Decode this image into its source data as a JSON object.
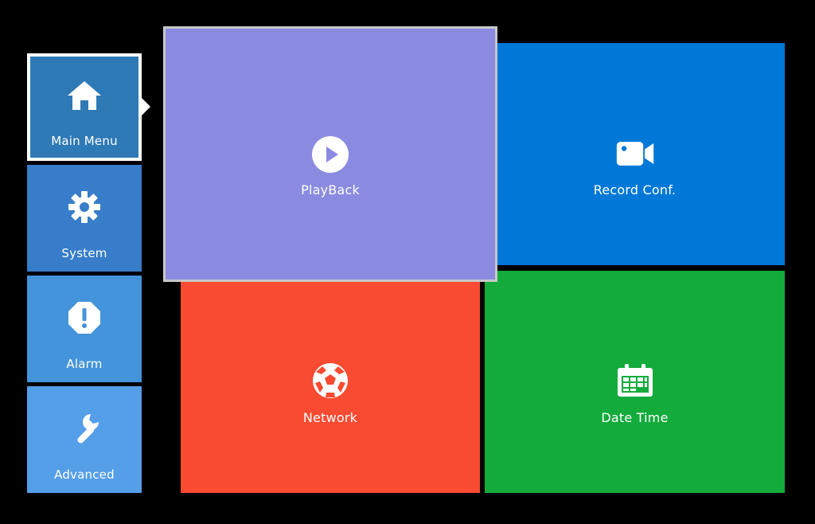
{
  "sidebar": {
    "items": [
      {
        "label": "Main Menu",
        "icon": "home-icon",
        "selected": true
      },
      {
        "label": "System",
        "icon": "gear-icon"
      },
      {
        "label": "Alarm",
        "icon": "alert-octagon-icon"
      },
      {
        "label": "Advanced",
        "icon": "wrench-icon"
      }
    ]
  },
  "tiles": {
    "playback": {
      "label": "PlayBack",
      "icon": "play-circle-icon",
      "color": "#8a8be0",
      "focused": true
    },
    "record": {
      "label": "Record Conf.",
      "icon": "video-camera-icon",
      "color": "#0078d7"
    },
    "network": {
      "label": "Network",
      "icon": "soccer-ball-icon",
      "color": "#f94b32"
    },
    "datetime": {
      "label": "Date Time",
      "icon": "calendar-icon",
      "color": "#13ab3c"
    }
  },
  "colors": {
    "background": "#000000",
    "sidebar_main": "#2e7ab7",
    "sidebar_system": "#377dc9",
    "sidebar_alarm": "#4494db",
    "sidebar_advanced": "#559ee8",
    "selection_border": "#ffffff"
  }
}
